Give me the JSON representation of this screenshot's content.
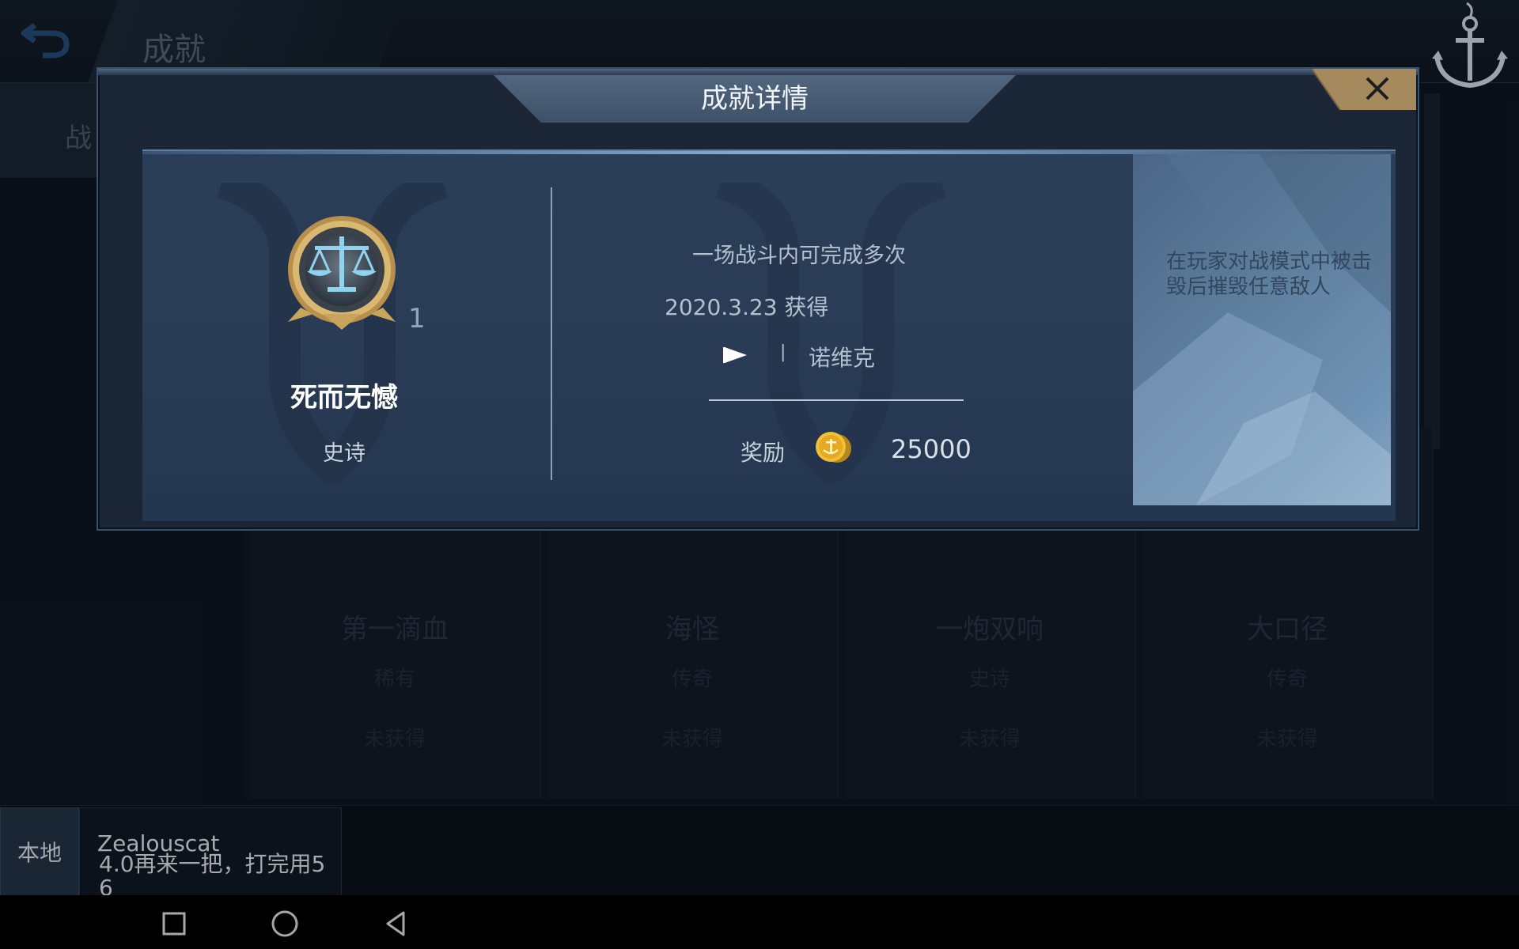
{
  "background": {
    "title": "成就",
    "left_nav_label": "战",
    "cards": [
      {
        "name": "第一滴血",
        "rarity": "稀有",
        "status": "未获得"
      },
      {
        "name": "海怪",
        "rarity": "传奇",
        "status": "未获得"
      },
      {
        "name": "一炮双响",
        "rarity": "史诗",
        "status": "未获得"
      },
      {
        "name": "大口径",
        "rarity": "传奇",
        "status": "未获得"
      }
    ]
  },
  "dialog": {
    "title": "成就详情",
    "achievement": {
      "name": "死而无憾",
      "rarity": "史诗",
      "count": "1",
      "description": "一场战斗内可完成多次",
      "obtained": "2020.3.23 获得",
      "separator": "|",
      "ship": "诺维克",
      "reward_label": "奖励",
      "reward_amount": "25000",
      "condition": "在玩家对战模式中被击毁后摧毁任意敌人"
    }
  },
  "chat": {
    "channel": "本地",
    "user": "Zealouscat",
    "message": "4.0再来一把，打完用5 6"
  },
  "icons": {
    "back": "back-arrow-icon",
    "logo": "anchor-icon",
    "close": "close-icon",
    "badge": "scales-badge-icon",
    "flag": "flag-icon",
    "coin": "gold-coin-icon"
  },
  "colors": {
    "background": "#0d1622",
    "dialog": "#1b2637",
    "panel": "#2a3c56",
    "close_button": "#a58a5e",
    "coin": "#e6b12c"
  }
}
